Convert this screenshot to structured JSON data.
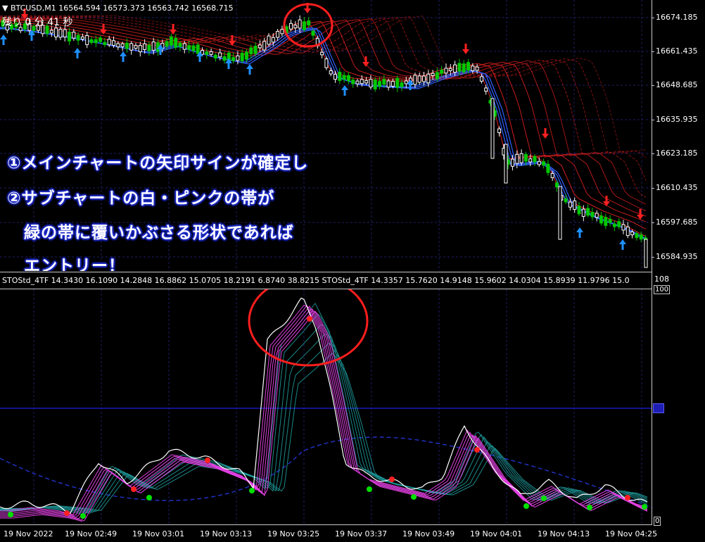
{
  "main_chart": {
    "header": "▼ BTCUSD,M1  16564.594 16573.373 16563.742 16568.715",
    "timer": "残り 0 分 41 秒",
    "price_labels": [
      "16674.185",
      "16661.435",
      "16648.685",
      "16635.935",
      "16623.185",
      "16610.435",
      "16597.685",
      "16584.935"
    ],
    "annotation_lines": [
      "①メインチャートの矢印サインが確定し",
      "②サブチャートの白・ピンクの帯が",
      "　緑の帯に覆いかぶさる形状であれば",
      "　エントリー！"
    ],
    "colors": {
      "bull": "#00c800",
      "bear": "#ffffff",
      "buy_arrow": "#1e90ff",
      "sell_arrow": "#ff2020",
      "ribbon_red": "#e02020",
      "ribbon_blue": "#3060ff",
      "grid": "#1e1e64",
      "highlight_circle": "#ff1e1e"
    }
  },
  "sub_chart": {
    "header": "STOStd_4TF 14.3430 16.1090 14.2848 16.8862 15.0705 18.2191 6.8740 38.8215  STOStd_4TF 14.3357 15.7620 14.9148 15.9602 14.0304 15.8939 11.9796 15.0",
    "scale_top": "108",
    "scale_100": "100",
    "scale_0": "0",
    "colors": {
      "white_line": "#ffffff",
      "pink_band": "#e040e0",
      "green_band": "#20a0a0",
      "level_line": "#2020e0",
      "buy_dot": "#00e000",
      "sell_dot": "#ff2020"
    }
  },
  "time_labels": [
    "19 Nov 2022",
    "19 Nov 02:49",
    "19 Nov 03:01",
    "19 Nov 03:13",
    "19 Nov 03:25",
    "19 Nov 03:37",
    "19 Nov 03:49",
    "19 Nov 04:01",
    "19 Nov 04:13",
    "19 Nov 04:25"
  ]
}
